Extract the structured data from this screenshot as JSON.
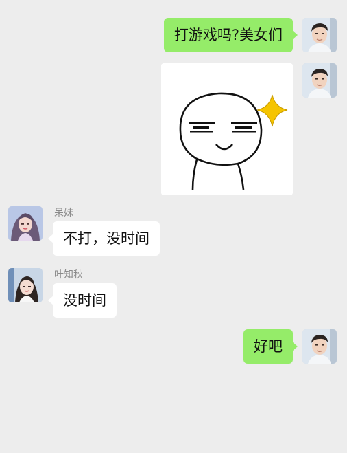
{
  "messages": [
    {
      "sender": "me",
      "text": "打游戏吗?美女们"
    },
    {
      "sender": "me",
      "type": "sticker",
      "sticker": "smug-face-sparkle"
    },
    {
      "sender": "other",
      "name": "呆妹",
      "text": "不打，没时间"
    },
    {
      "sender": "other",
      "name": "叶知秋",
      "text": "没时间"
    },
    {
      "sender": "me",
      "text": "好吧"
    }
  ],
  "colors": {
    "background": "#ededed",
    "my_bubble": "#95ec69",
    "other_bubble": "#ffffff",
    "sender_name": "#8a8a8a",
    "sparkle": "#f5c400"
  },
  "icons": {
    "my_avatar": "male-portrait-avatar",
    "daimei_avatar": "female-portrait-avatar",
    "yezhiqiu_avatar": "female-portrait-avatar",
    "sticker_sparkle": "sparkle-icon"
  }
}
